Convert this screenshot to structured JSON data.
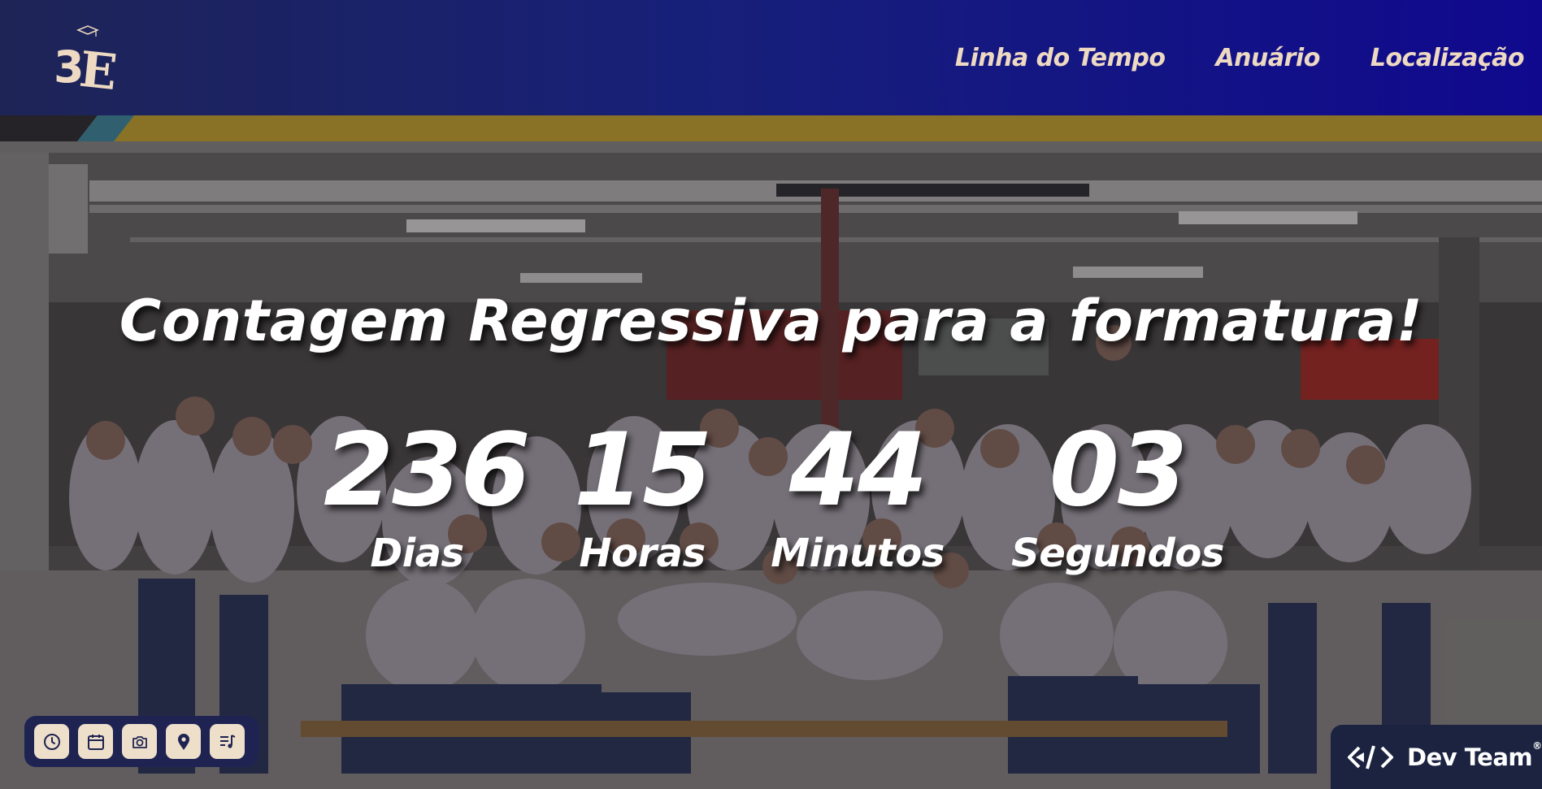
{
  "header": {
    "logo_text": "3E",
    "nav": [
      {
        "label": "Linha do Tempo"
      },
      {
        "label": "Anuário"
      },
      {
        "label": "Localização"
      }
    ]
  },
  "hero": {
    "title": "Contagem Regressiva para a formatura!",
    "countdown": [
      {
        "value": "236",
        "label": "Dias"
      },
      {
        "value": "15",
        "label": "Horas"
      },
      {
        "value": "44",
        "label": "Minutos"
      },
      {
        "value": "03",
        "label": "Segundos"
      }
    ]
  },
  "toolbar": {
    "buttons": [
      {
        "icon": "clock-icon"
      },
      {
        "icon": "calendar-icon"
      },
      {
        "icon": "camera-icon"
      },
      {
        "icon": "location-pin-icon"
      },
      {
        "icon": "playlist-music-icon"
      }
    ]
  },
  "badge": {
    "label": "Dev Team",
    "mark": "®"
  },
  "colors": {
    "header_start": "#1e2456",
    "header_end": "#10098e",
    "nav_text": "#eed9c2",
    "toolbar_bg": "#1e2352",
    "toolbar_button": "#eedfcb"
  }
}
